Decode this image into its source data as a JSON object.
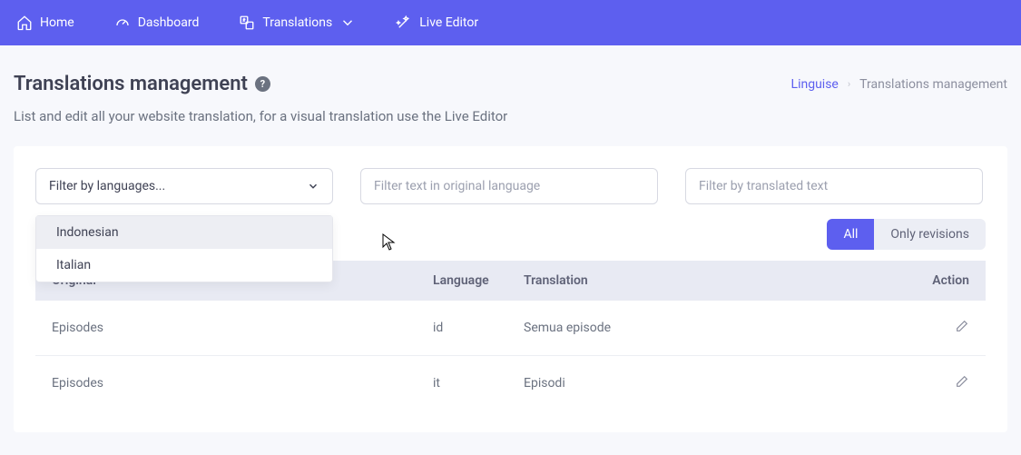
{
  "nav": {
    "home": "Home",
    "dashboard": "Dashboard",
    "translations": "Translations",
    "live_editor": "Live Editor"
  },
  "page": {
    "title": "Translations management",
    "subtitle": "List and edit all your website translation, for a visual translation use the Live Editor"
  },
  "breadcrumb": {
    "root": "Linguise",
    "current": "Translations management"
  },
  "filters": {
    "lang_placeholder": "Filter by languages...",
    "original_placeholder": "Filter text in original language",
    "translated_placeholder": "Filter by translated text",
    "dropdown": [
      "Indonesian",
      "Italian"
    ]
  },
  "toggle": {
    "all": "All",
    "revisions": "Only revisions"
  },
  "table": {
    "headers": {
      "original": "Original",
      "language": "Language",
      "translation": "Translation",
      "action": "Action"
    },
    "rows": [
      {
        "original": "Episodes",
        "language": "id",
        "translation": "Semua episode"
      },
      {
        "original": "Episodes",
        "language": "it",
        "translation": "Episodi"
      }
    ]
  }
}
